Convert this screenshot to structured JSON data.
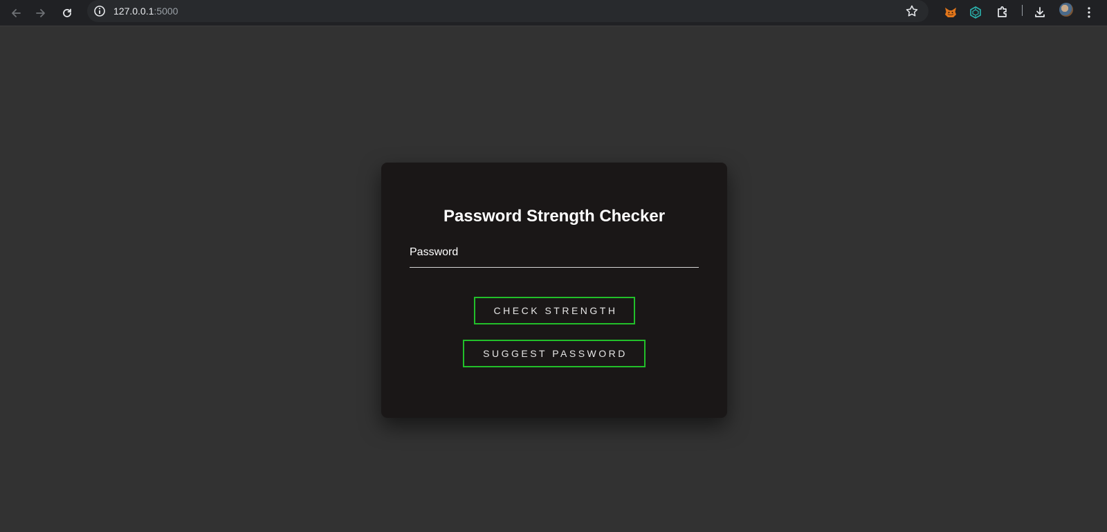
{
  "browser": {
    "url_host": "127.0.0.1",
    "url_port": ":5000",
    "icons": {
      "back": "arrow-left-icon",
      "forward": "arrow-right-icon",
      "reload": "reload-icon",
      "site_info": "info-icon",
      "bookmark": "star-icon",
      "extension_1": "metamask-fox-icon",
      "extension_2": "teal-extension-icon",
      "extensions": "puzzle-icon",
      "downloads": "download-icon",
      "profile": "avatar",
      "menu": "kebab-menu-icon"
    }
  },
  "card": {
    "title": "Password Strength Checker",
    "password_label": "Password",
    "password_value": "",
    "check_button": "CHECK STRENGTH",
    "suggest_button": "SUGGEST PASSWORD"
  },
  "colors": {
    "page_background": "#323232",
    "card_background": "#1a1717",
    "button_border": "#22c02a",
    "text": "#ffffff"
  }
}
